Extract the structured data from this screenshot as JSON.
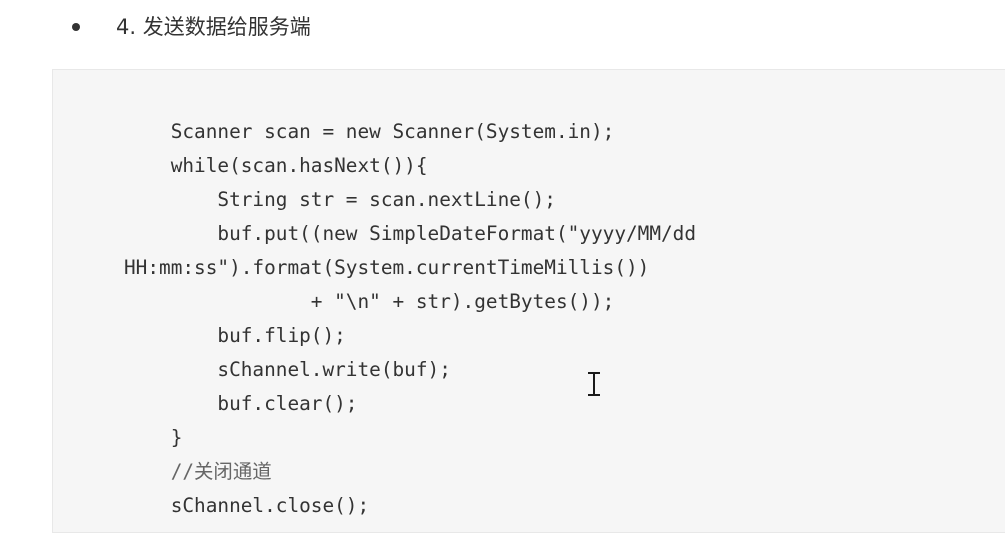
{
  "step": {
    "bullet": "•",
    "heading": "4. 发送数据给服务端"
  },
  "code": {
    "lines": [
      "    Scanner scan = new Scanner(System.in);",
      "    while(scan.hasNext()){",
      "        String str = scan.nextLine();",
      "        buf.put((new SimpleDateFormat(\"yyyy/MM/dd",
      "HH:mm:ss\").format(System.currentTimeMillis())",
      "                + \"\\n\" + str).getBytes());",
      "        buf.flip();",
      "        sChannel.write(buf);",
      "        buf.clear();",
      "    }",
      "    //关闭通道",
      "    sChannel.close();"
    ]
  },
  "cursor": {
    "icon": "text-cursor-icon"
  }
}
